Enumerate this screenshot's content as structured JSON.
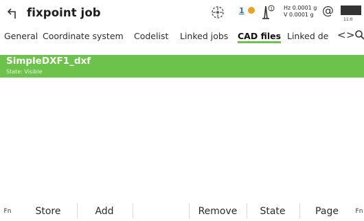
{
  "window": {
    "title": "fixpoint job"
  },
  "status": {
    "satellites": "1",
    "hz": "Hz 0.0001 g",
    "v": "V  0.0001 g",
    "at_symbol": "@",
    "time": "11:0"
  },
  "tabs": [
    {
      "label": "General",
      "active": false
    },
    {
      "label": "Coordinate system",
      "active": false
    },
    {
      "label": "Codelist",
      "active": false
    },
    {
      "label": "Linked jobs",
      "active": false
    },
    {
      "label": "CAD files",
      "active": true
    },
    {
      "label": "Linked de",
      "active": false
    }
  ],
  "nav": {
    "prev": "<",
    "next": ">"
  },
  "list": {
    "items": [
      {
        "name": "SimpleDXF1_dxf",
        "state": "State: Visible",
        "selected": true
      }
    ]
  },
  "softkeys": {
    "fn_left": "Fn",
    "store": "Store",
    "add": "Add",
    "remove": "Remove",
    "state": "State",
    "page": "Page",
    "fn_right": "Fn"
  },
  "colors": {
    "accent": "#6cc24a",
    "satellite_badge": "#2b6fb9",
    "satellite_dot": "#e8a326"
  },
  "icons": {
    "back": "back-arrow-icon",
    "target": "target-crosshair-icon",
    "tilt": "tilt-compensator-icon",
    "battery": "battery-icon",
    "search": "search-icon"
  }
}
